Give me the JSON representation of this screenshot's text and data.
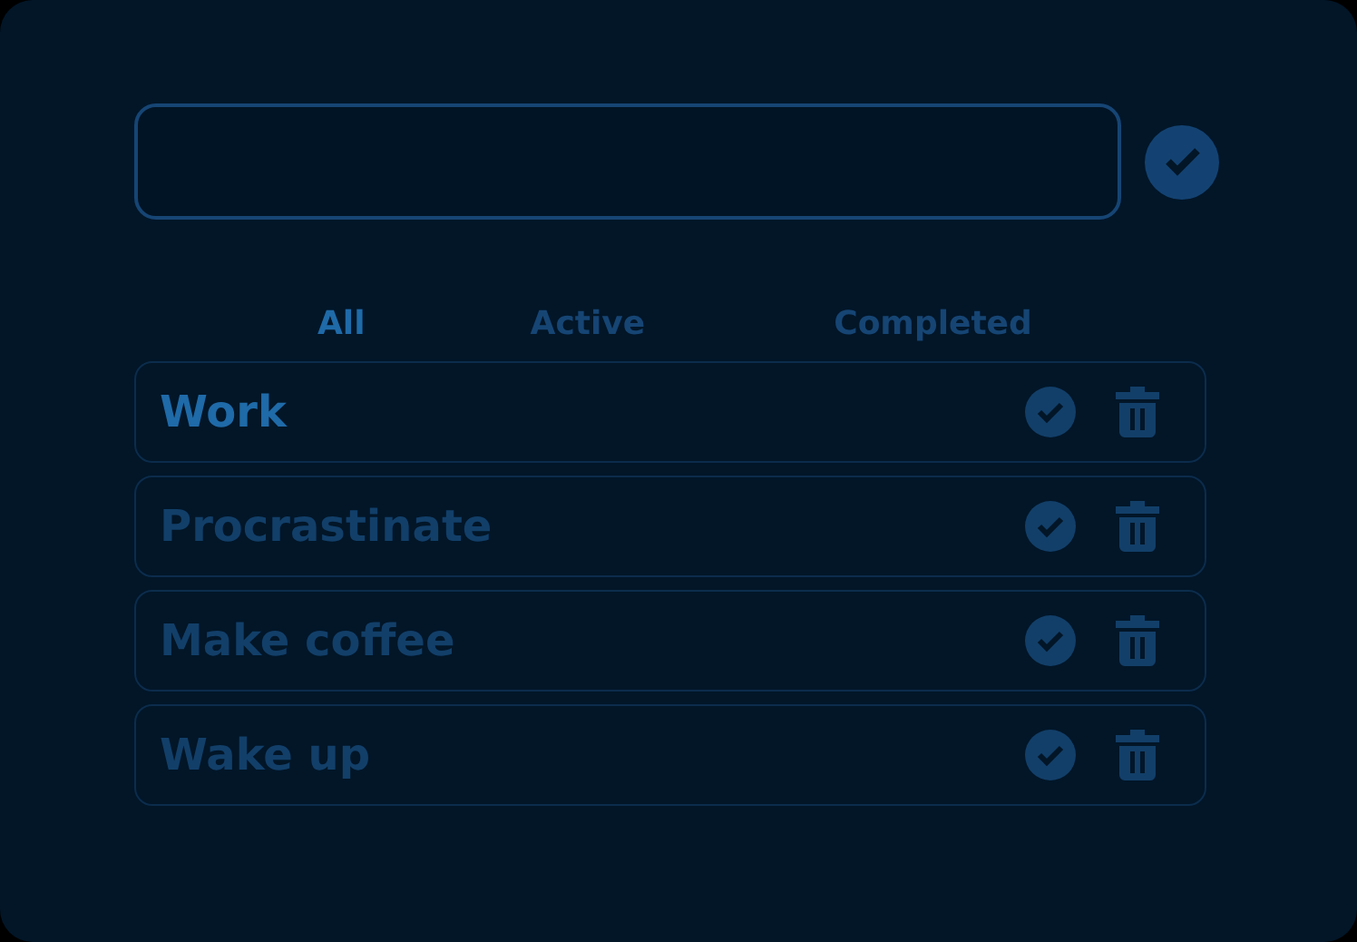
{
  "filters": [
    {
      "label": "All",
      "selected": true
    },
    {
      "label": "Active",
      "selected": false
    },
    {
      "label": "Completed",
      "selected": false
    }
  ],
  "tasks": [
    {
      "text": "Work",
      "completed": false
    },
    {
      "text": "Procrastinate",
      "completed": true
    },
    {
      "text": "Make coffee",
      "completed": true
    },
    {
      "text": "Wake up",
      "completed": true
    }
  ]
}
